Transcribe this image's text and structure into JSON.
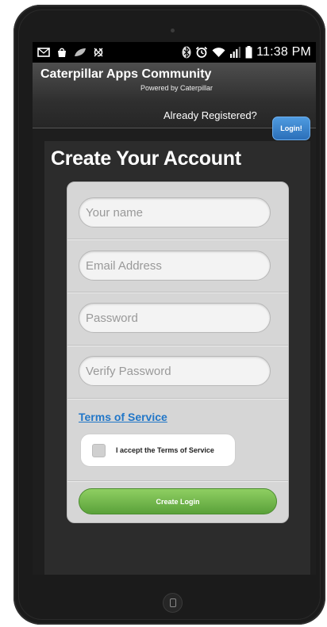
{
  "status_bar": {
    "time": "11:38 PM",
    "icons": [
      "mail-icon",
      "shop-icon",
      "leaf-icon",
      "sync-icon",
      "bluetooth-icon",
      "alarm-icon",
      "wifi-icon",
      "signal-icon",
      "battery-icon"
    ]
  },
  "header": {
    "title": "Caterpillar Apps Community",
    "subtitle": "Powered by Caterpillar",
    "already_registered": "Already Registered?",
    "login_label": "Login!"
  },
  "form": {
    "title": "Create Your Account",
    "name_placeholder": "Your name",
    "email_placeholder": "Email Address",
    "password_placeholder": "Password",
    "verify_placeholder": "Verify Password",
    "tos_link": "Terms of Service",
    "accept_label": "I accept the Terms of Service",
    "accept_checked": false,
    "submit_label": "Create Login"
  },
  "colors": {
    "link": "#2277c8",
    "login_button": "#2b6fb9",
    "submit_button": "#5aa13a"
  }
}
